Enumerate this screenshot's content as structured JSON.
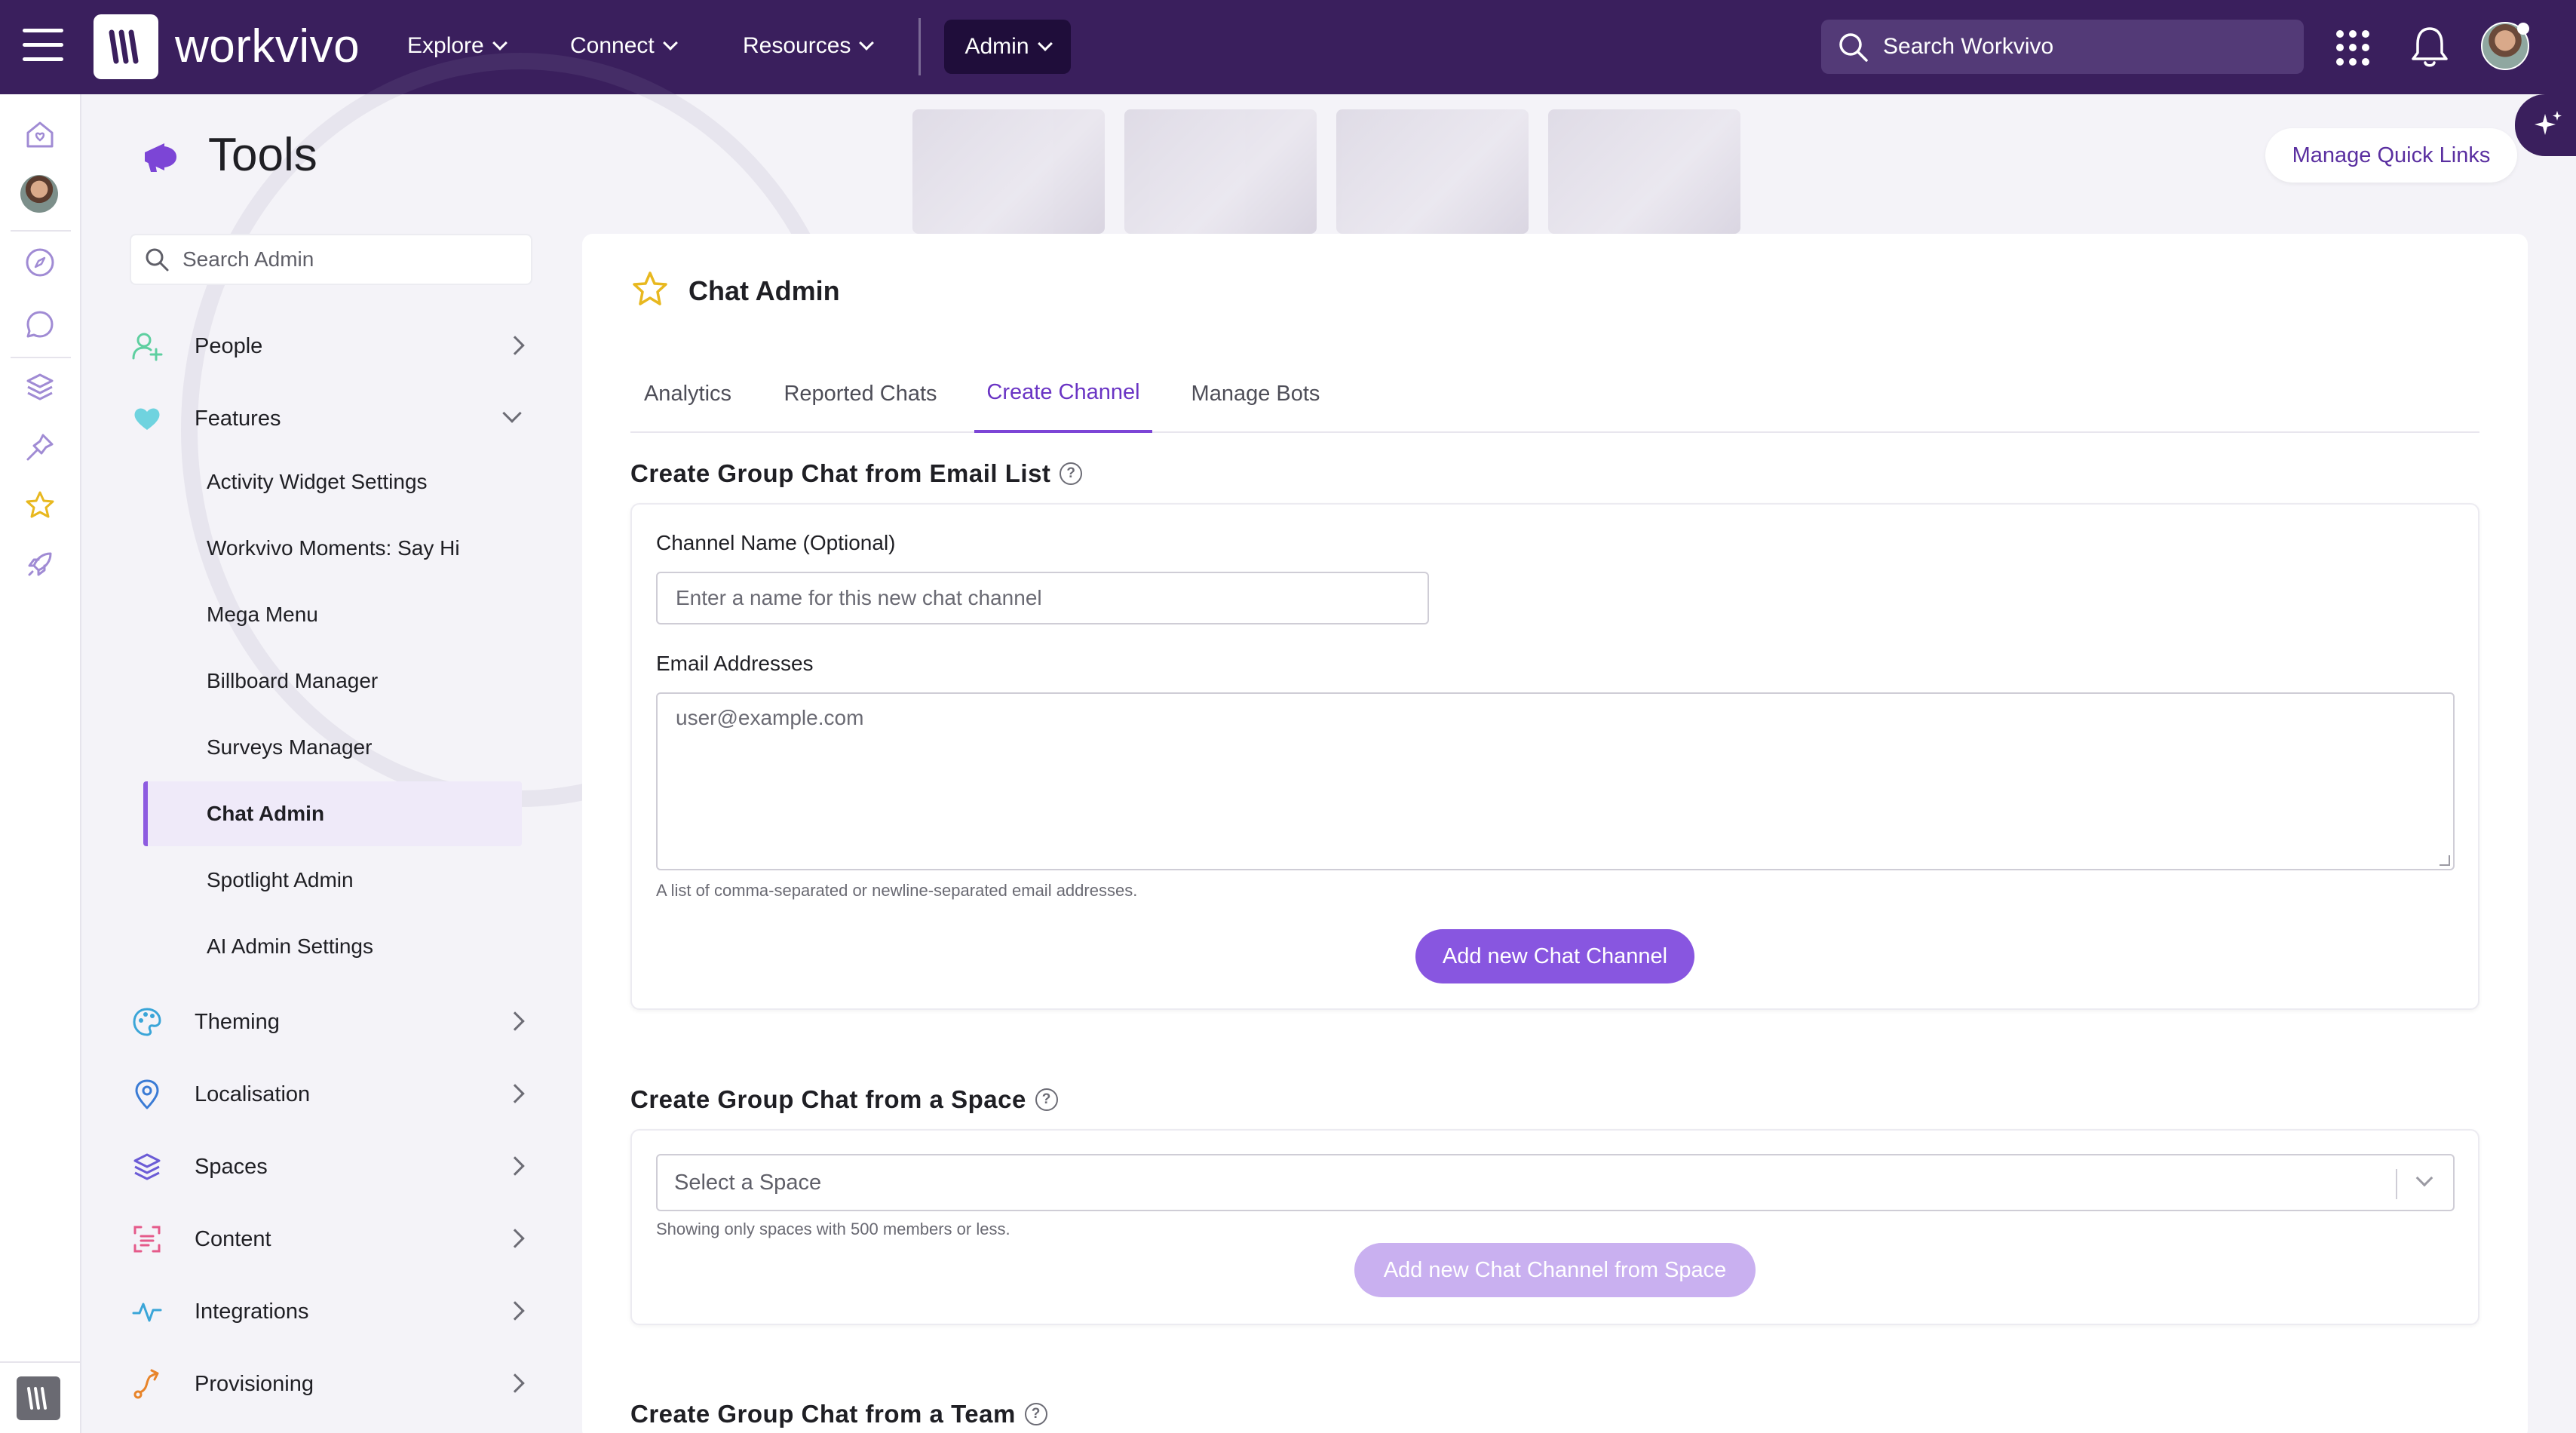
{
  "topbar": {
    "brand": "workvivo",
    "nav": [
      "Explore",
      "Connect",
      "Resources"
    ],
    "admin_label": "Admin",
    "search_placeholder": "Search Workvivo"
  },
  "page": {
    "title": "Tools",
    "quick_links_label": "Manage Quick Links"
  },
  "sidebar": {
    "search_placeholder": "Search Admin",
    "sections": [
      {
        "label": "People",
        "icon": "add-user-icon",
        "state": "collapsed"
      },
      {
        "label": "Features",
        "icon": "heart-icon",
        "state": "expanded"
      },
      {
        "label": "Theming",
        "icon": "palette-icon",
        "state": "collapsed"
      },
      {
        "label": "Localisation",
        "icon": "location-pin-icon",
        "state": "collapsed"
      },
      {
        "label": "Spaces",
        "icon": "layers-icon",
        "state": "collapsed"
      },
      {
        "label": "Content",
        "icon": "scan-icon",
        "state": "collapsed"
      },
      {
        "label": "Integrations",
        "icon": "activity-icon",
        "state": "collapsed"
      },
      {
        "label": "Provisioning",
        "icon": "route-icon",
        "state": "collapsed"
      }
    ],
    "feature_items": [
      "Activity Widget Settings",
      "Workvivo Moments: Say Hi",
      "Mega Menu",
      "Billboard Manager",
      "Surveys Manager",
      "Chat Admin",
      "Spotlight Admin",
      "AI Admin Settings"
    ],
    "active_item": "Chat Admin"
  },
  "chat_admin": {
    "title": "Chat Admin",
    "tabs": [
      "Analytics",
      "Reported Chats",
      "Create Channel",
      "Manage Bots"
    ],
    "active_tab": "Create Channel",
    "email_section": {
      "title": "Create Group Chat from Email List",
      "channel_name_label": "Channel Name (Optional)",
      "channel_name_placeholder": "Enter a name for this new chat channel",
      "emails_label": "Email Addresses",
      "emails_placeholder": "user@example.com",
      "emails_hint": "A list of comma-separated or newline-separated email addresses.",
      "submit_label": "Add new Chat Channel"
    },
    "space_section": {
      "title": "Create Group Chat from a Space",
      "select_placeholder": "Select a Space",
      "hint": "Showing only spaces with 500 members or less.",
      "submit_label": "Add new Chat Channel from Space"
    },
    "team_section": {
      "title": "Create Group Chat from a Team"
    }
  },
  "colors": {
    "topbar": "#3a1f5d",
    "accent": "#8856e0",
    "accent_disabled": "#c9b0f0",
    "active_tab": "#6a34c4"
  }
}
